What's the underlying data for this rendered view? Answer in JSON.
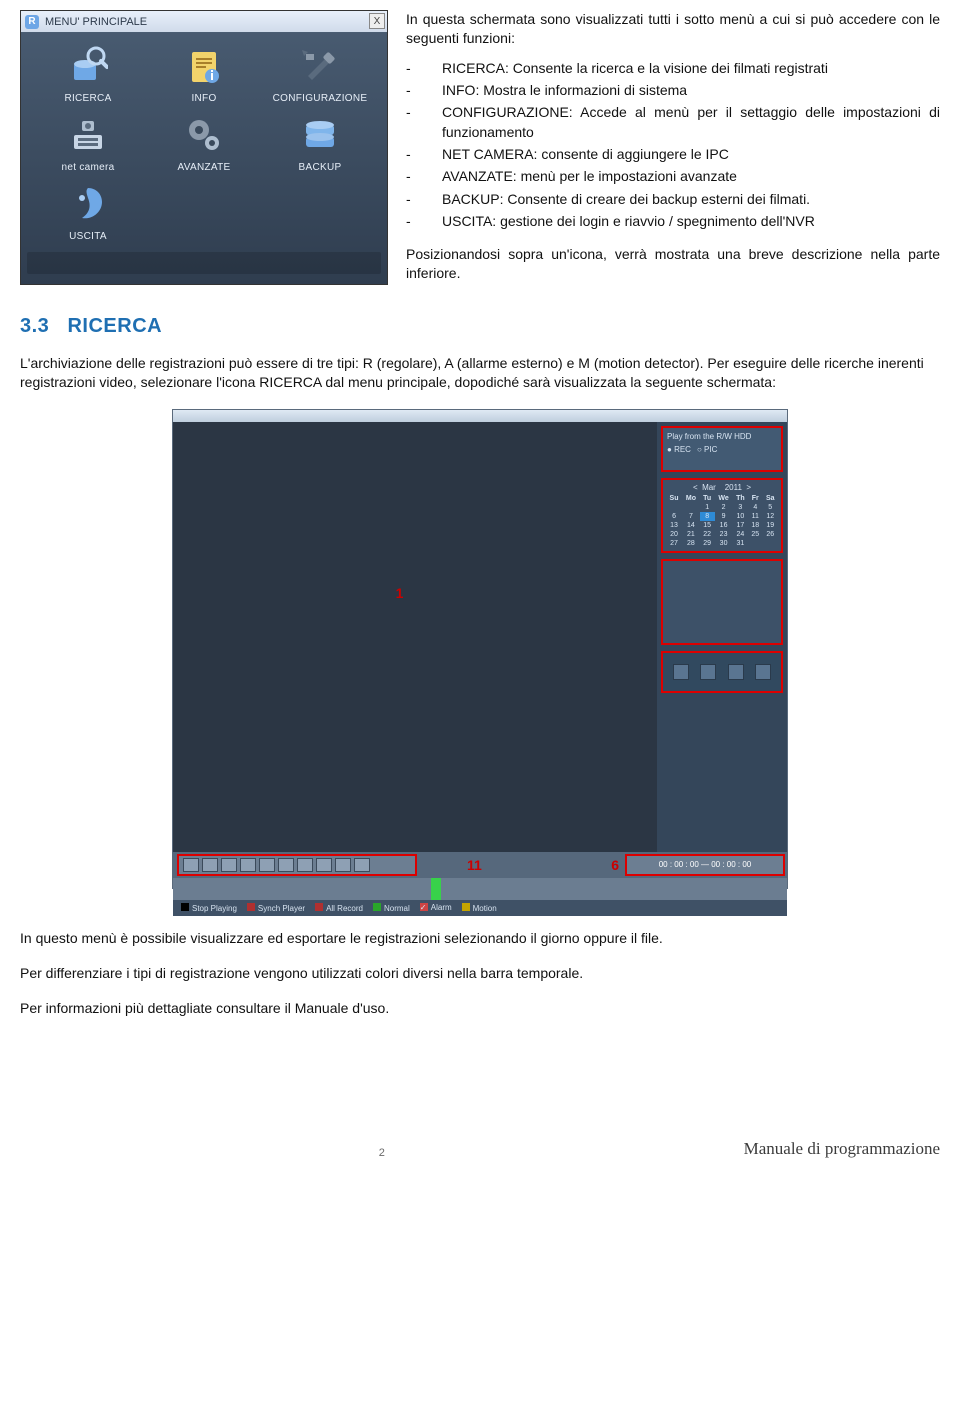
{
  "menu_window": {
    "title": "MENU' PRINCIPALE",
    "icon_letter": "R",
    "close": "X",
    "items": [
      {
        "label": "RICERCA",
        "icon": "search"
      },
      {
        "label": "INFO",
        "icon": "info"
      },
      {
        "label": "CONFIGURAZIONE",
        "icon": "config"
      },
      {
        "label": "net camera",
        "icon": "netcam"
      },
      {
        "label": "AVANZATE",
        "icon": "gears"
      },
      {
        "label": "BACKUP",
        "icon": "backup"
      },
      {
        "label": "USCITA",
        "icon": "exit"
      }
    ]
  },
  "intro": {
    "lead": "In questa schermata sono visualizzati tutti i sotto menù a cui si può accedere con le seguenti funzioni:",
    "list": [
      "RICERCA: Consente la ricerca e la visione dei filmati registrati",
      "INFO: Mostra le informazioni di sistema",
      "CONFIGURAZIONE: Accede al menù per il settaggio delle impostazioni di funzionamento",
      "NET CAMERA: consente di aggiungere le IPC",
      "AVANZATE:  menù per le impostazioni avanzate",
      "BACKUP: Consente di creare dei backup esterni dei filmati.",
      "USCITA: gestione dei login e riavvio / spegnimento dell'NVR"
    ],
    "position_note": "Posizionandosi sopra un'icona, verrà mostrata una breve descrizione nella parte inferiore."
  },
  "section": {
    "num": "3.3",
    "title": "RICERCA"
  },
  "paragraphs": {
    "p1": "L'archiviazione delle registrazioni può essere di tre tipi: R (regolare), A (allarme esterno) e M (motion detector). Per eseguire delle ricerche inerenti registrazioni video, selezionare l'icona RICERCA dal menu principale, dopodiché sarà visualizzata la seguente schermata:",
    "p2": "In questo menù è possibile visualizzare ed esportare le registrazioni selezionando il giorno oppure il file.",
    "p3": "Per differenziare i tipi di registrazione vengono utilizzati  colori diversi nella barra temporale.",
    "p4": "Per informazioni più dettagliate consultare il Manuale d'uso."
  },
  "search_window": {
    "source_label": "Play from the R/W HDD",
    "opt_rec": "REC",
    "opt_pic": "PIC",
    "cal_month": "Mar",
    "cal_year": "2011",
    "cal_days": [
      "Su",
      "Mo",
      "Tu",
      "We",
      "Th",
      "Fr",
      "Sa"
    ],
    "cal_rows": [
      [
        "",
        "",
        "1",
        "2",
        "3",
        "4",
        "5"
      ],
      [
        "6",
        "7",
        "8",
        "9",
        "10",
        "11",
        "12"
      ],
      [
        "13",
        "14",
        "15",
        "16",
        "17",
        "18",
        "19"
      ],
      [
        "20",
        "21",
        "22",
        "23",
        "24",
        "25",
        "26"
      ],
      [
        "27",
        "28",
        "29",
        "30",
        "31",
        "",
        ""
      ]
    ],
    "selected_day": "8",
    "timecode": "00 : 00 : 00 — 00 : 00 : 00",
    "markers": {
      "m1": "1",
      "m6": "6",
      "m11": "11"
    },
    "legend": [
      {
        "label": "Stop Playing",
        "color": "#000"
      },
      {
        "label": "Synch Player",
        "color": "#b03030"
      },
      {
        "label": "All Record",
        "color": "#b03030"
      },
      {
        "label": "Normal",
        "color": "#2aa62a"
      },
      {
        "label": "Alarm",
        "color": "#c44"
      },
      {
        "label": "Motion",
        "color": "#c4a400"
      }
    ]
  },
  "footer": {
    "page": "2",
    "title": "Manuale di programmazione"
  }
}
